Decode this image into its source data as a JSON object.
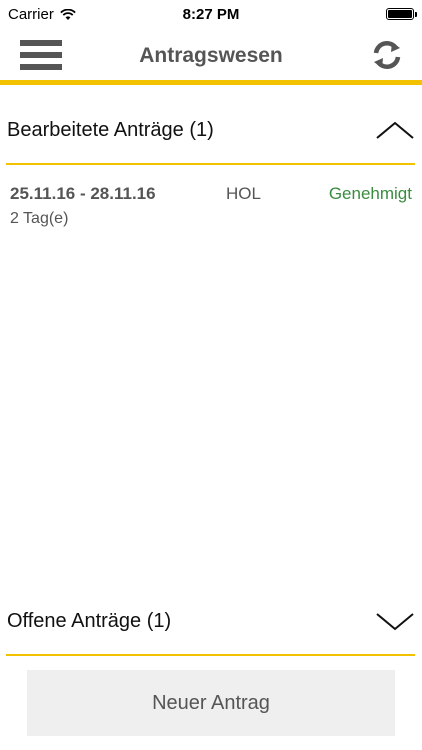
{
  "status_bar": {
    "carrier": "Carrier",
    "time": "8:27 PM"
  },
  "nav": {
    "title": "Antragswesen",
    "menu_icon": "hamburger-icon",
    "refresh_icon": "refresh-icon"
  },
  "sections": {
    "processed": {
      "title": "Bearbeitete Anträge (1)",
      "expanded": true,
      "items": [
        {
          "dates": "25.11.16 - 28.11.16",
          "duration": "2 Tag(e)",
          "type": "HOL",
          "status": "Genehmigt"
        }
      ]
    },
    "open": {
      "title": "Offene Anträge (1)",
      "expanded": false
    }
  },
  "new_request_label": "Neuer Antrag",
  "colors": {
    "accent": "#f2c200",
    "approved": "#3a8c3f",
    "text_gray": "#555555",
    "button_bg": "#efefef"
  }
}
